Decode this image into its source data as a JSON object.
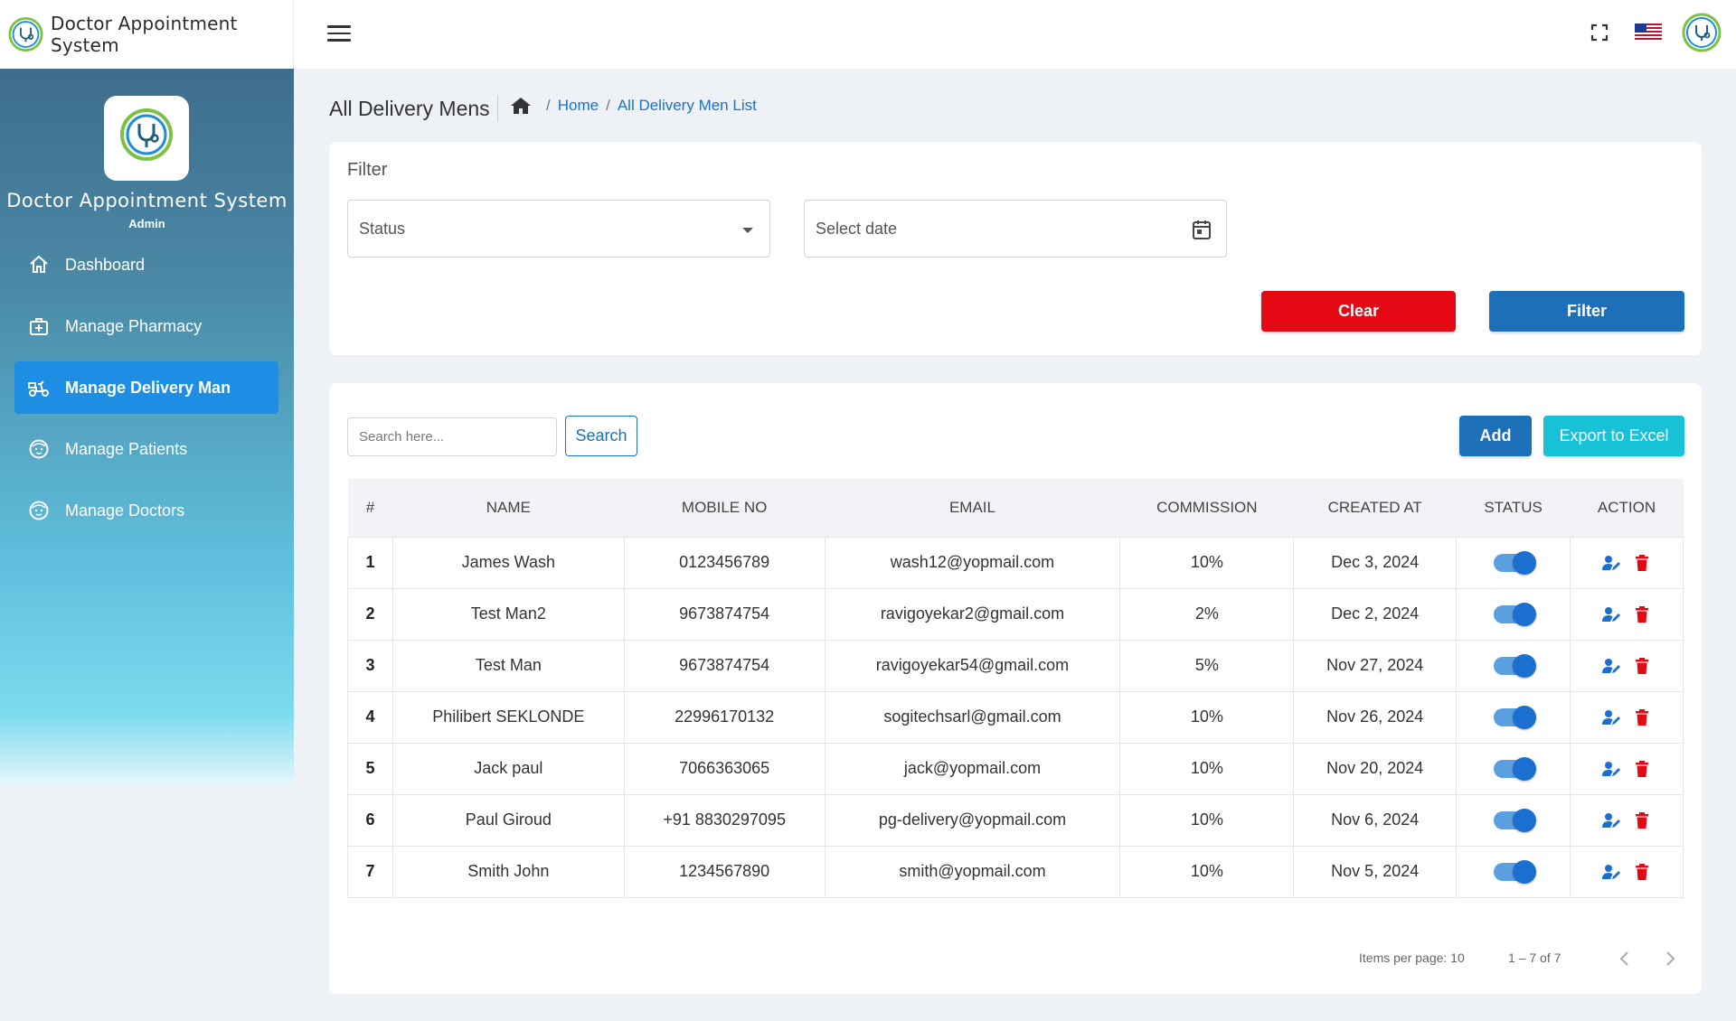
{
  "app": {
    "title": "Doctor Appointment System",
    "role": "Admin",
    "logo_caption": "Doctor Appointment System"
  },
  "sidebar": {
    "items": [
      {
        "label": "Dashboard",
        "icon": "home-icon",
        "active": false
      },
      {
        "label": "Manage Pharmacy",
        "icon": "medical-kit-icon",
        "active": false
      },
      {
        "label": "Manage Delivery Man",
        "icon": "delivery-scooter-icon",
        "active": true
      },
      {
        "label": "Manage Patients",
        "icon": "face-icon",
        "active": false
      },
      {
        "label": "Manage Doctors",
        "icon": "face-icon",
        "active": false
      }
    ]
  },
  "page": {
    "title": "All Delivery Mens",
    "breadcrumb": {
      "home": "Home",
      "current": "All Delivery Men List"
    }
  },
  "filter": {
    "title": "Filter",
    "status_placeholder": "Status",
    "date_placeholder": "Select date",
    "clear_label": "Clear",
    "filter_label": "Filter"
  },
  "toolbar": {
    "search_placeholder": "Search here...",
    "search_label": "Search",
    "add_label": "Add",
    "export_label": "Export to Excel"
  },
  "table": {
    "columns": [
      "#",
      "NAME",
      "MOBILE NO",
      "EMAIL",
      "COMMISSION",
      "CREATED AT",
      "STATUS",
      "ACTION"
    ],
    "rows": [
      {
        "num": "1",
        "name": "James Wash",
        "mobile": "0123456789",
        "email": "wash12@yopmail.com",
        "commission": "10%",
        "created": "Dec 3, 2024",
        "status": true
      },
      {
        "num": "2",
        "name": "Test Man2",
        "mobile": "9673874754",
        "email": "ravigoyekar2@gmail.com",
        "commission": "2%",
        "created": "Dec 2, 2024",
        "status": true
      },
      {
        "num": "3",
        "name": "Test Man",
        "mobile": "9673874754",
        "email": "ravigoyekar54@gmail.com",
        "commission": "5%",
        "created": "Nov 27, 2024",
        "status": true
      },
      {
        "num": "4",
        "name": "Philibert SEKLONDE",
        "mobile": "22996170132",
        "email": "sogitechsarl@gmail.com",
        "commission": "10%",
        "created": "Nov 26, 2024",
        "status": true
      },
      {
        "num": "5",
        "name": "Jack paul",
        "mobile": "7066363065",
        "email": "jack@yopmail.com",
        "commission": "10%",
        "created": "Nov 20, 2024",
        "status": true
      },
      {
        "num": "6",
        "name": "Paul Giroud",
        "mobile": "+91 8830297095",
        "email": "pg-delivery@yopmail.com",
        "commission": "10%",
        "created": "Nov 6, 2024",
        "status": true
      },
      {
        "num": "7",
        "name": "Smith John",
        "mobile": "1234567890",
        "email": "smith@yopmail.com",
        "commission": "10%",
        "created": "Nov 5, 2024",
        "status": true
      }
    ]
  },
  "pagination": {
    "items_per_page": "Items per page: 10",
    "range": "1 – 7 of 7"
  },
  "colors": {
    "primary": "#1d6fb8",
    "clear": "#e50914",
    "export": "#17c1d8",
    "toggle": "#1a6fd0",
    "edit": "#1a6fd0",
    "delete": "#e50914"
  }
}
